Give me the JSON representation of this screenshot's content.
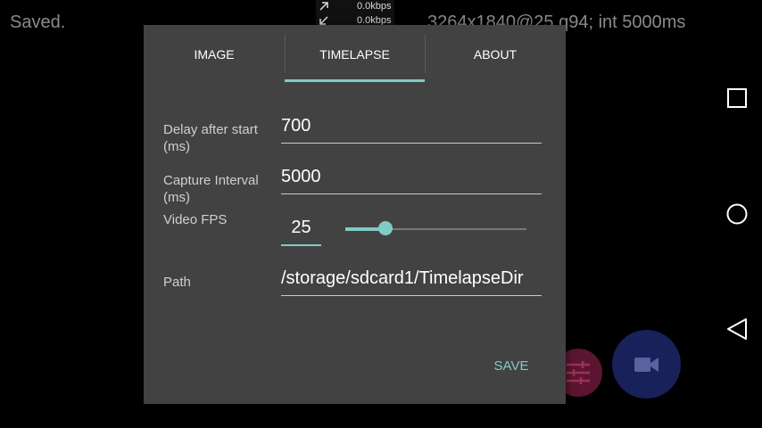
{
  "status": {
    "saved": "Saved.",
    "resolution": "3264x1840@25 q94; int 5000ms"
  },
  "net": {
    "up_icon": "arrow-up-right-icon",
    "up": "0.0kbps",
    "down_icon": "arrow-down-left-icon",
    "down": "0.0kbps"
  },
  "tabs": [
    {
      "label": "IMAGE",
      "selected": false
    },
    {
      "label": "TIMELAPSE",
      "selected": true
    },
    {
      "label": "ABOUT",
      "selected": false
    }
  ],
  "form": {
    "delay_label": "Delay after start (ms)",
    "delay_value": "700",
    "interval_label": "Capture Interval (ms)",
    "interval_value": "5000",
    "fps_label": "Video FPS",
    "fps_value": "25",
    "fps_slider_fraction": 0.22,
    "path_label": "Path",
    "path_value": "/storage/sdcard1/TimelapseDir"
  },
  "actions": {
    "save": "SAVE"
  },
  "nav": {
    "recents_icon": "square-icon",
    "home_icon": "circle-icon",
    "back_icon": "triangle-back-icon"
  },
  "fabs": {
    "settings_icon": "sliders-icon",
    "video_icon": "video-camera-icon"
  },
  "colors": {
    "accent": "#80cbc4",
    "dialog_bg": "#424242",
    "fab_video": "#19215a",
    "fab_settings": "#5c1530"
  }
}
